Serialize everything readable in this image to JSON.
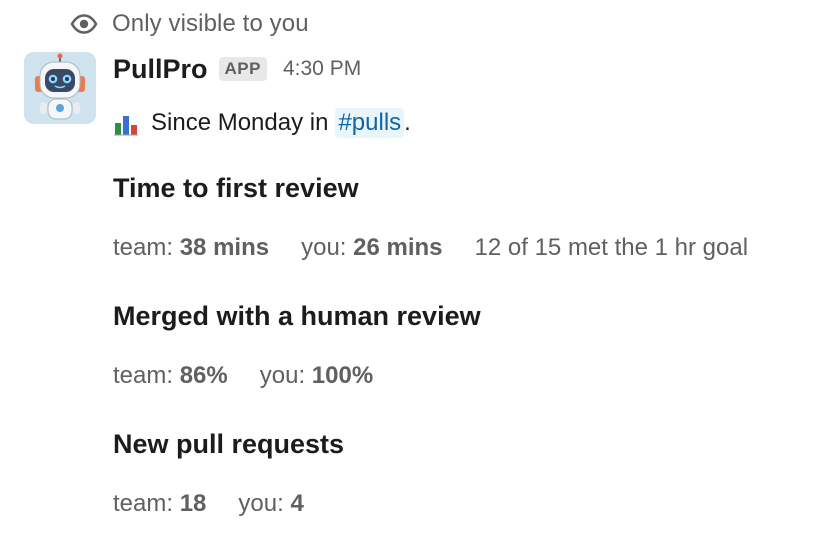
{
  "visibility_note": "Only visible to you",
  "message": {
    "sender": "PullPro",
    "badge": "APP",
    "time": "4:30 PM",
    "intro": {
      "text": "Since Monday in",
      "channel": "#pulls",
      "suffix": "."
    }
  },
  "sections": [
    {
      "title": "Time to first review",
      "team_label": "team:",
      "team_value": "38 mins",
      "you_label": "you:",
      "you_value": "26 mins",
      "note": "12 of 15 met the 1 hr goal"
    },
    {
      "title": "Merged with a human review",
      "team_label": "team:",
      "team_value": "86%",
      "you_label": "you:",
      "you_value": "100%"
    },
    {
      "title": "New pull requests",
      "team_label": "team:",
      "team_value": "18",
      "you_label": "you:",
      "you_value": "4"
    }
  ],
  "colors": {
    "text": "#1d1c1d",
    "muted": "#616061",
    "link": "#1264a3",
    "link_bg": "#e8f5fa",
    "badge_bg": "#e8e8e8"
  },
  "icons": {
    "visibility": "eye-icon",
    "intro": "bar-chart-icon",
    "avatar": "robot-avatar"
  }
}
